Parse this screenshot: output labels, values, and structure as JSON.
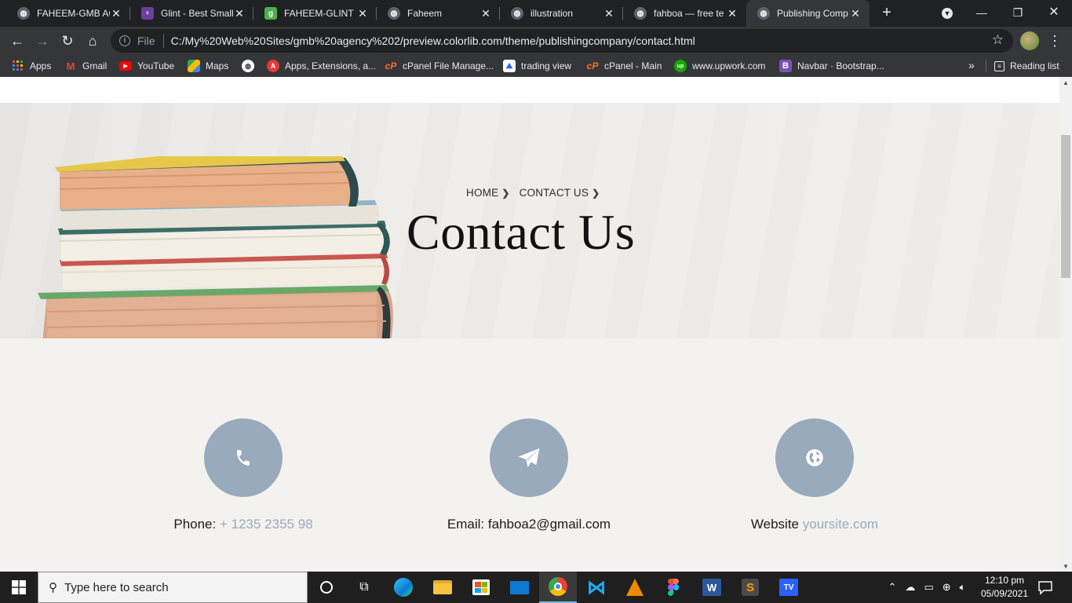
{
  "browser": {
    "tabs": [
      {
        "title": "FAHEEM-GMB AC",
        "favicon": "globe-icon",
        "color": "#5f6368"
      },
      {
        "title": "Glint - Best Small",
        "favicon": "colorlib-icon",
        "color": "#6b3fa0"
      },
      {
        "title": "FAHEEM-GLINT",
        "favicon": "g-icon",
        "color": "#4caf50"
      },
      {
        "title": "Faheem",
        "favicon": "globe-icon",
        "color": "#5f6368"
      },
      {
        "title": "illustration",
        "favicon": "globe-icon",
        "color": "#5f6368"
      },
      {
        "title": "fahboa — free te",
        "favicon": "globe-icon",
        "color": "#5f6368"
      },
      {
        "title": "Publishing Comp",
        "favicon": "globe-icon",
        "color": "#5f6368",
        "active": true
      }
    ],
    "address": {
      "scheme": "File",
      "url": "C:/My%20Web%20Sites/gmb%20agency%202/preview.colorlib.com/theme/publishingcompany/contact.html"
    },
    "bookmarks": [
      {
        "label": "Apps",
        "icon": "apps-grid-icon",
        "color": "#ea4335"
      },
      {
        "label": "Gmail",
        "icon": "gmail-icon",
        "color": "#ea4335"
      },
      {
        "label": "YouTube",
        "icon": "youtube-icon",
        "color": "#ff0000"
      },
      {
        "label": "Maps",
        "icon": "maps-icon",
        "color": "#34a853"
      },
      {
        "label": "",
        "icon": "globe-icon",
        "color": "#ffffff"
      },
      {
        "label": "Apps, Extensions, a...",
        "icon": "adobe-icon",
        "color": "#e53935"
      },
      {
        "label": "cPanel File Manage...",
        "icon": "cpanel-icon",
        "color": "#ff6c2c"
      },
      {
        "label": "trading view",
        "icon": "tradingview-icon",
        "color": "#2962ff"
      },
      {
        "label": "cPanel - Main",
        "icon": "cpanel-icon",
        "color": "#ff6c2c"
      },
      {
        "label": "www.upwork.com",
        "icon": "upwork-icon",
        "color": "#14a800"
      },
      {
        "label": "Navbar · Bootstrap...",
        "icon": "bootstrap-icon",
        "color": "#7952b3"
      }
    ],
    "more": "»",
    "reading_list": "Reading list"
  },
  "page": {
    "breadcrumb": [
      "HOME",
      "CONTACT US"
    ],
    "title": "Contact Us",
    "contacts": [
      {
        "icon": "phone-icon",
        "label": "Phone:",
        "value": "+ 1235 2355 98",
        "muted": true
      },
      {
        "icon": "paper-plane-icon",
        "label": "Email:",
        "value": "fahboa2@gmail.com",
        "muted": false
      },
      {
        "icon": "globe-icon",
        "label": "Website",
        "value": "yoursite.com",
        "muted": true
      }
    ],
    "accent": "#98aabb"
  },
  "taskbar": {
    "search_placeholder": "Type here to search",
    "time": "12:10 pm",
    "date": "05/09/2021"
  }
}
